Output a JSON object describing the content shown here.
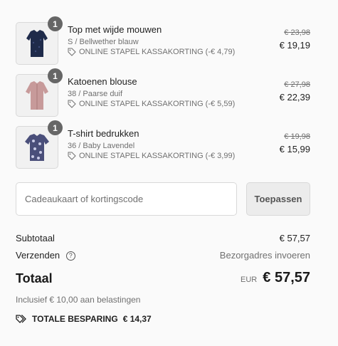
{
  "items": [
    {
      "quantity": "1",
      "name": "Top met wijde mouwen",
      "variant": "S / Bellwether blauw",
      "discount": "ONLINE STAPEL KASSAKORTING (-€ 4,79)",
      "old_price": "€ 23,98",
      "new_price": "€ 19,19",
      "image": "navy-top-thumbnail",
      "color": "#1e2a4a"
    },
    {
      "quantity": "1",
      "name": "Katoenen blouse",
      "variant": "38 / Paarse duif",
      "discount": "ONLINE STAPEL KASSAKORTING (-€ 5,59)",
      "old_price": "€ 27,98",
      "new_price": "€ 22,39",
      "image": "mauve-blouse-thumbnail",
      "color": "#c79a9a"
    },
    {
      "quantity": "1",
      "name": "T-shirt bedrukken",
      "variant": "36 / Baby Lavendel",
      "discount": "ONLINE STAPEL KASSAKORTING (-€ 3,99)",
      "old_price": "€ 19,98",
      "new_price": "€ 15,99",
      "image": "printed-tshirt-thumbnail",
      "color": "#4a4f7a"
    }
  ],
  "discount_code": {
    "placeholder": "Cadeaukaart of kortingscode",
    "value": "",
    "apply_label": "Toepassen"
  },
  "summary": {
    "subtotal_label": "Subtotaal",
    "subtotal_value": "€ 57,57",
    "shipping_label": "Verzenden",
    "shipping_help_icon": "question-circle-icon",
    "shipping_value": "Bezorgadres invoeren",
    "total_label": "Totaal",
    "currency": "EUR",
    "total_value": "€ 57,57",
    "tax_note": "Inclusief € 10,00 aan belastingen",
    "savings_icon": "tags-icon",
    "savings_label": "TOTALE BESPARING",
    "savings_value": "€ 14,37"
  }
}
